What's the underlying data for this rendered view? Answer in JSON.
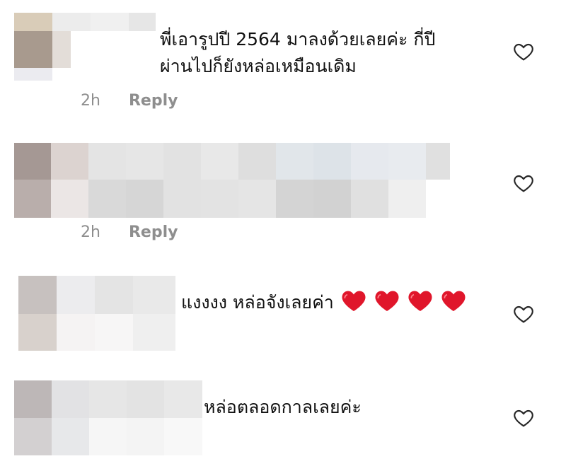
{
  "colors": {
    "text": "#111111",
    "meta": "#8e8e8e",
    "heart_outline": "#262626",
    "heart_emoji": "#e0162b"
  },
  "comments": [
    {
      "text_line1": "พี่เอารูปปี 2564 มาลงด้วยเลยค่ะ กี่ปี",
      "text_line2": "ผ่านไปก็ยังหล่อเหมือนเดิม",
      "time": "2h",
      "reply_label": "Reply",
      "like_icon": "heart-outline-icon"
    },
    {
      "text_line1": "",
      "time": "2h",
      "reply_label": "Reply",
      "like_icon": "heart-outline-icon"
    },
    {
      "text_line1": "แงงงง หล่อจังเลยค่า",
      "emoji": "red-heart-emoji",
      "emoji_count": 4,
      "like_icon": "heart-outline-icon"
    },
    {
      "text_line1": "หล่อตลอดกาลเลยค่ะ",
      "like_icon": "heart-outline-icon"
    }
  ]
}
